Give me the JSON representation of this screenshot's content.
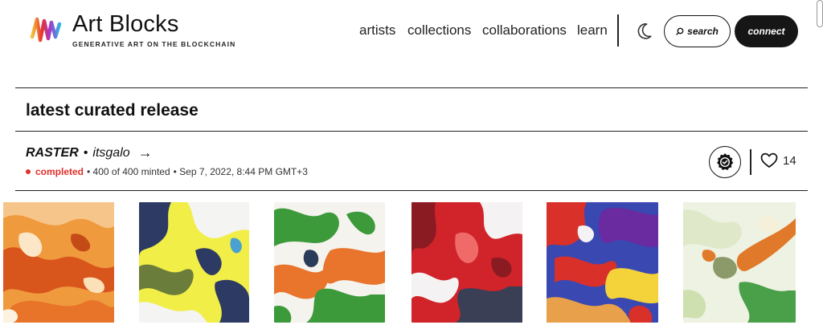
{
  "brand": {
    "name": "Art Blocks",
    "tagline": "GENERATIVE ART ON THE BLOCKCHAIN"
  },
  "nav": {
    "items": [
      {
        "label": "artists"
      },
      {
        "label": "collections"
      },
      {
        "label": "collaborations"
      },
      {
        "label": "learn"
      }
    ],
    "search_label": "search",
    "connect_label": "connect"
  },
  "section": {
    "title": "latest curated release"
  },
  "project": {
    "name": "RASTER",
    "separator": "•",
    "artist": "itsgalo",
    "arrow": "→",
    "status": "completed",
    "minted": "• 400 of 400 minted",
    "date": "• Sep 7, 2022, 8:44 PM GMT+3",
    "likes": "14"
  },
  "colors": {
    "accent_dark": "#161616",
    "status_red": "#e0302b"
  },
  "icons": {
    "theme": "moon-icon",
    "search": "search-icon",
    "curated": "verified-badge-icon",
    "like": "heart-icon",
    "link": "arrow-right-icon"
  },
  "gallery": {
    "items": [
      {
        "name": "artwork-1",
        "palette": [
          "#e8742a",
          "#f2a24a",
          "#c44a18",
          "#fbe7c8"
        ]
      },
      {
        "name": "artwork-2",
        "palette": [
          "#e6e32a",
          "#2d3a63",
          "#f4f4f2",
          "#6b7d3b"
        ]
      },
      {
        "name": "artwork-3",
        "palette": [
          "#3c9a3a",
          "#e8752b",
          "#f5f3ee",
          "#2b3b5a"
        ]
      },
      {
        "name": "artwork-4",
        "palette": [
          "#d0232a",
          "#f4f2f2",
          "#3a3f55",
          "#8a1b22"
        ]
      },
      {
        "name": "artwork-5",
        "palette": [
          "#3a48b2",
          "#d9302a",
          "#f3d23a",
          "#6a2aa0"
        ]
      },
      {
        "name": "artwork-6",
        "palette": [
          "#eef2e2",
          "#e07a2a",
          "#4aa048",
          "#8c9a6a"
        ]
      }
    ]
  }
}
